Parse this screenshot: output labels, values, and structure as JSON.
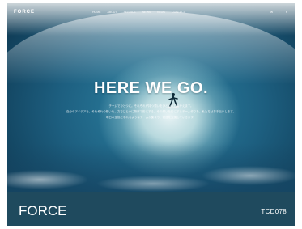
{
  "hero": {
    "logo": "FORCE",
    "nav": [
      "HOME",
      "ABOUT",
      "SERVICE",
      "NEWS",
      "BLOG",
      "CONTACT"
    ],
    "social": [
      "✉",
      "t",
      "f"
    ],
    "headline": "HERE WE GO.",
    "description": [
      "チームでひとつに。それぞれが持つ想いをひとつの力にかえます。",
      "自分のアイデアを、それぞれの想いを、力でひとつに繋げて形にする。その想いを形にするチーム作りを、私たちはお手伝いします。",
      "明日の主役になれるようなチームが集まり、前進を支援していきます。"
    ]
  },
  "footer": {
    "title": "FORCE",
    "code": "TCD078"
  }
}
